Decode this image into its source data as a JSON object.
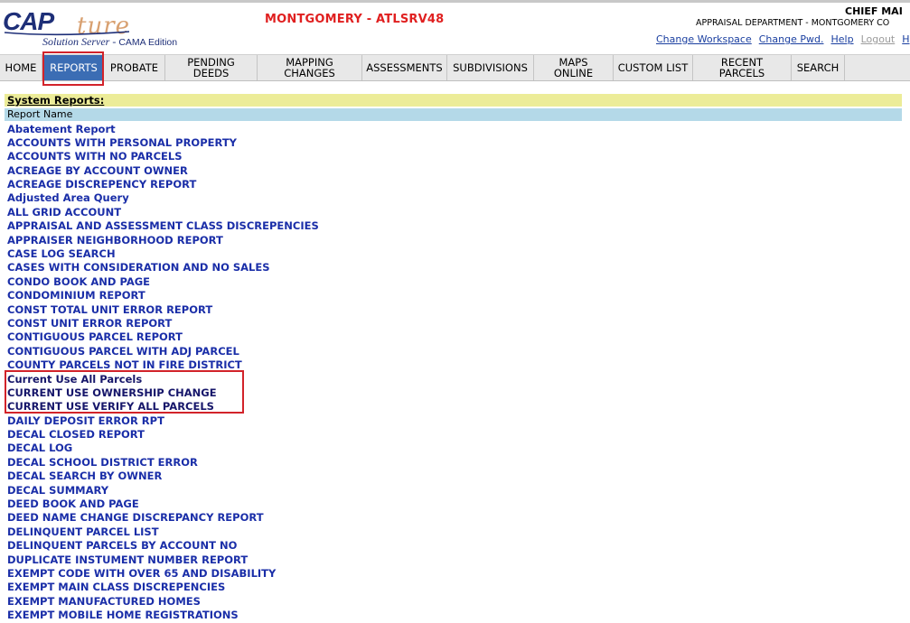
{
  "header": {
    "logo_cap": "CAP",
    "logo_ture": "ture",
    "logo_subtitle": "Solution Server - ",
    "logo_edition": "CAMA Edition",
    "server_title": "MONTGOMERY - ATLSRV48",
    "user_name": "CHIEF  MAI",
    "department": "APPRAISAL DEPARTMENT  -  MONTGOMERY CO",
    "links": {
      "change_workspace": "Change Workspace",
      "change_pwd": "Change Pwd.",
      "help": "Help",
      "logout": "Logout",
      "cut": "H"
    }
  },
  "nav": {
    "home": "HOME",
    "reports": "REPORTS",
    "probate": "PROBATE",
    "pending_deeds": "PENDING DEEDS",
    "mapping_changes": "MAPPING CHANGES",
    "assessments": "ASSESSMENTS",
    "subdivisions": "SUBDIVISIONS",
    "maps_online": "MAPS ONLINE",
    "custom_list": "CUSTOM LIST",
    "recent_parcels": "RECENT PARCELS",
    "search": "SEARCH",
    "active": "REPORTS"
  },
  "reports": {
    "section_title": "System Reports:",
    "column_header": "Report Name",
    "items": [
      "Abatement Report",
      "ACCOUNTS WITH PERSONAL PROPERTY",
      "ACCOUNTS WITH NO PARCELS",
      "ACREAGE BY ACCOUNT OWNER",
      "ACREAGE DISCREPENCY REPORT",
      "Adjusted Area Query",
      "ALL GRID ACCOUNT",
      "APPRAISAL AND ASSESSMENT CLASS DISCREPENCIES",
      "APPRAISER NEIGHBORHOOD REPORT",
      "CASE LOG SEARCH",
      "CASES WITH CONSIDERATION AND NO SALES",
      "CONDO BOOK AND PAGE",
      "CONDOMINIUM REPORT",
      "CONST TOTAL UNIT ERROR REPORT",
      "CONST UNIT ERROR REPORT",
      "CONTIGUOUS PARCEL REPORT",
      "CONTIGUOUS PARCEL WITH ADJ PARCEL",
      "COUNTY PARCELS NOT IN FIRE DISTRICT",
      "Current Use All Parcels",
      "CURRENT USE OWNERSHIP CHANGE",
      "CURRENT USE VERIFY ALL PARCELS",
      "DAILY DEPOSIT ERROR RPT",
      "DECAL CLOSED REPORT",
      "DECAL LOG",
      "DECAL SCHOOL DISTRICT ERROR",
      "DECAL SEARCH BY OWNER",
      "DECAL SUMMARY",
      "DEED BOOK AND PAGE",
      "DEED NAME CHANGE DISCREPANCY REPORT",
      "DELINQUENT PARCEL LIST",
      "DELINQUENT PARCELS BY ACCOUNT NO",
      "DUPLICATE INSTUMENT NUMBER REPORT",
      "EXEMPT CODE WITH OVER 65 AND DISABILITY",
      "EXEMPT MAIN CLASS DISCREPENCIES",
      "EXEMPT MANUFACTURED HOMES",
      "EXEMPT MOBILE HOME REGISTRATIONS"
    ]
  },
  "colors": {
    "accent_blue": "#3b6db4",
    "link_blue": "#1a2ea8",
    "server_red": "#e02020",
    "highlight_red": "#d2232a",
    "section_yellow": "#ecec98",
    "header_blue": "#b4d9e8"
  }
}
